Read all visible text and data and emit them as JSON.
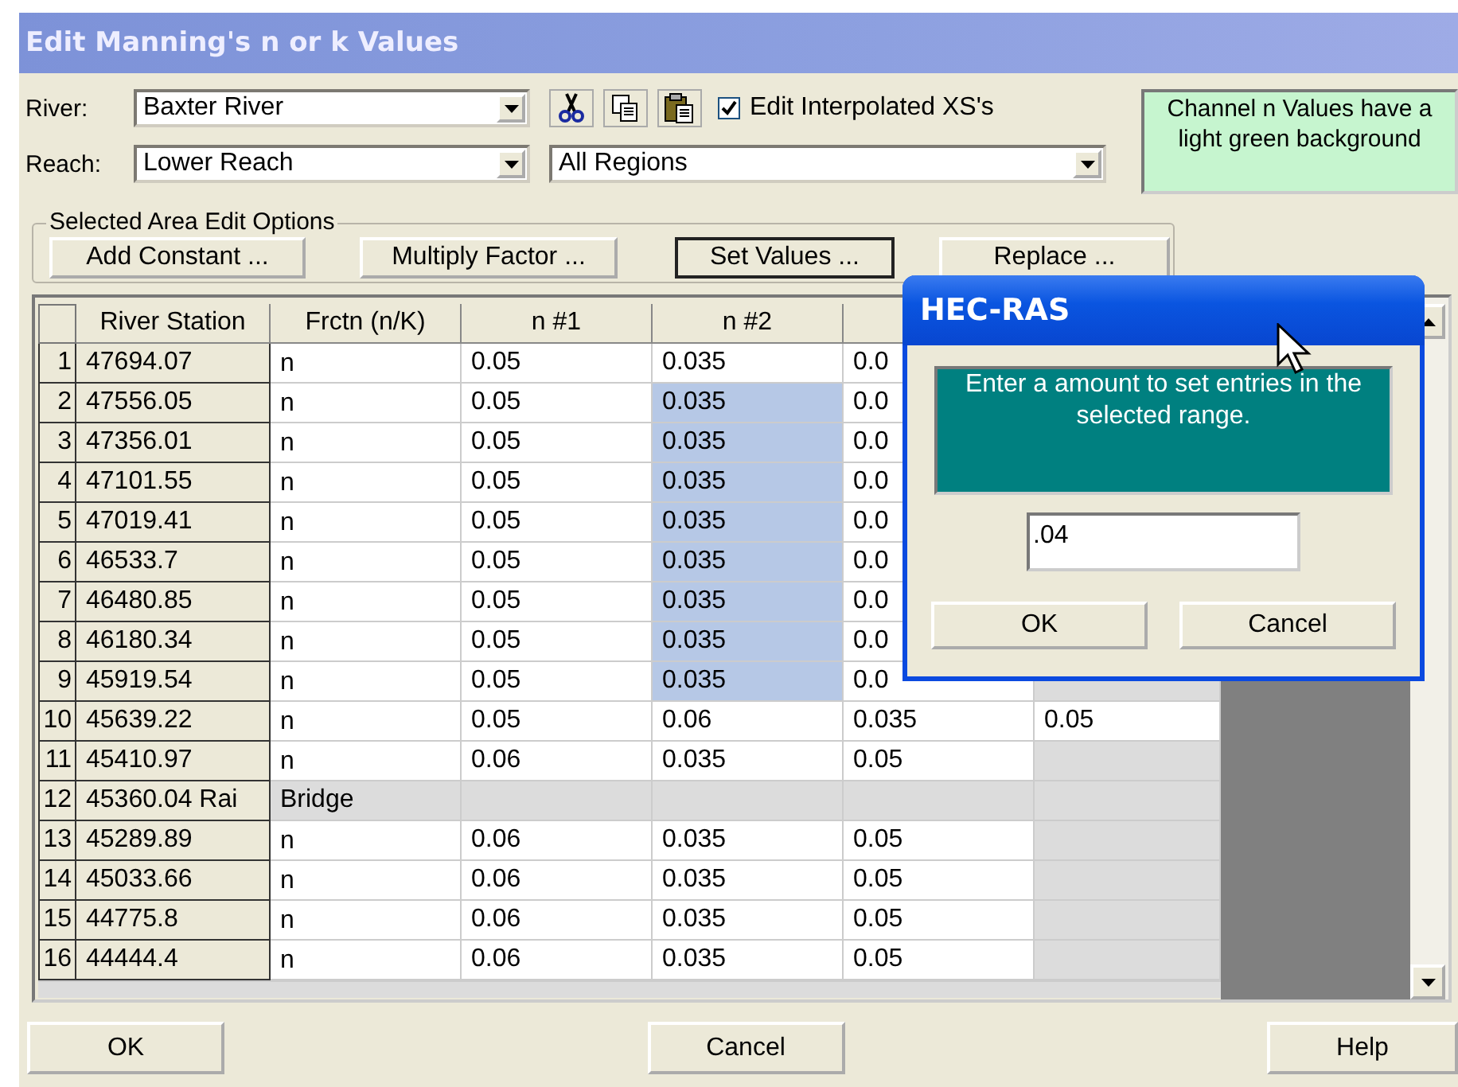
{
  "window": {
    "title": "Edit Manning's n or k Values"
  },
  "river": {
    "label": "River:",
    "value": "Baxter River"
  },
  "reach": {
    "label": "Reach:",
    "value": "Lower Reach"
  },
  "regions": {
    "value": "All Regions"
  },
  "interpolated": {
    "label": "Edit Interpolated XS's",
    "checked": true
  },
  "note": "Channel n Values have a light green background",
  "edit_options": {
    "title": "Selected Area Edit Options",
    "buttons": [
      {
        "label": "Add Constant ...",
        "focused": false
      },
      {
        "label": "Multiply Factor ...",
        "focused": false
      },
      {
        "label": "Set Values ...",
        "focused": true
      },
      {
        "label": "Replace ...",
        "focused": false
      }
    ]
  },
  "table": {
    "columns": [
      "River Station",
      "Frctn (n/K)",
      "n #1",
      "n #2"
    ],
    "rows": [
      {
        "num": "1",
        "station": "47694.07",
        "kind": "xs",
        "frctn": "n",
        "cells": [
          {
            "text": "0.05",
            "selected": false,
            "disabled": false
          },
          {
            "text": "0.035",
            "selected": false,
            "disabled": false
          },
          {
            "text": "0.0",
            "selected": false,
            "disabled": false
          }
        ]
      },
      {
        "num": "2",
        "station": "47556.05",
        "kind": "xs",
        "frctn": "n",
        "cells": [
          {
            "text": "0.05",
            "selected": false,
            "disabled": false
          },
          {
            "text": "0.035",
            "selected": true,
            "disabled": false
          },
          {
            "text": "0.0",
            "selected": false,
            "disabled": false
          }
        ]
      },
      {
        "num": "3",
        "station": "47356.01",
        "kind": "xs",
        "frctn": "n",
        "cells": [
          {
            "text": "0.05",
            "selected": false,
            "disabled": false
          },
          {
            "text": "0.035",
            "selected": true,
            "disabled": false
          },
          {
            "text": "0.0",
            "selected": false,
            "disabled": false
          }
        ]
      },
      {
        "num": "4",
        "station": "47101.55",
        "kind": "xs",
        "frctn": "n",
        "cells": [
          {
            "text": "0.05",
            "selected": false,
            "disabled": false
          },
          {
            "text": "0.035",
            "selected": true,
            "disabled": false
          },
          {
            "text": "0.0",
            "selected": false,
            "disabled": false
          }
        ]
      },
      {
        "num": "5",
        "station": "47019.41",
        "kind": "xs",
        "frctn": "n",
        "cells": [
          {
            "text": "0.05",
            "selected": false,
            "disabled": false
          },
          {
            "text": "0.035",
            "selected": true,
            "disabled": false
          },
          {
            "text": "0.0",
            "selected": false,
            "disabled": false
          }
        ]
      },
      {
        "num": "6",
        "station": "46533.7",
        "kind": "xs",
        "frctn": "n",
        "cells": [
          {
            "text": "0.05",
            "selected": false,
            "disabled": false
          },
          {
            "text": "0.035",
            "selected": true,
            "disabled": false
          },
          {
            "text": "0.0",
            "selected": false,
            "disabled": false
          }
        ]
      },
      {
        "num": "7",
        "station": "46480.85",
        "kind": "xs",
        "frctn": "n",
        "cells": [
          {
            "text": "0.05",
            "selected": false,
            "disabled": false
          },
          {
            "text": "0.035",
            "selected": true,
            "disabled": false
          },
          {
            "text": "0.0",
            "selected": false,
            "disabled": false
          }
        ]
      },
      {
        "num": "8",
        "station": "46180.34",
        "kind": "xs",
        "frctn": "n",
        "cells": [
          {
            "text": "0.05",
            "selected": false,
            "disabled": false
          },
          {
            "text": "0.035",
            "selected": true,
            "disabled": false
          },
          {
            "text": "0.0",
            "selected": false,
            "disabled": false
          }
        ]
      },
      {
        "num": "9",
        "station": "45919.54",
        "kind": "xs",
        "frctn": "n",
        "cells": [
          {
            "text": "0.05",
            "selected": false,
            "disabled": false
          },
          {
            "text": "0.035",
            "selected": true,
            "disabled": false
          },
          {
            "text": "0.0",
            "selected": false,
            "disabled": false
          }
        ]
      },
      {
        "num": "10",
        "station": "45639.22",
        "kind": "xs",
        "frctn": "n",
        "cells": [
          {
            "text": "0.05",
            "selected": false,
            "disabled": false
          },
          {
            "text": "0.06",
            "selected": false,
            "disabled": false
          },
          {
            "text": "0.035",
            "selected": false,
            "disabled": false
          },
          {
            "text": "0.05",
            "selected": false,
            "disabled": false
          }
        ]
      },
      {
        "num": "11",
        "station": "45410.97",
        "kind": "xs",
        "frctn": "n",
        "cells": [
          {
            "text": "0.06",
            "selected": false,
            "disabled": false
          },
          {
            "text": "0.035",
            "selected": false,
            "disabled": false
          },
          {
            "text": "0.05",
            "selected": false,
            "disabled": false
          },
          {
            "text": "",
            "selected": false,
            "disabled": true
          }
        ]
      },
      {
        "num": "12",
        "station": "45360.04 Rai",
        "kind": "bridge",
        "frctn": "Bridge",
        "cells": [
          {
            "text": "",
            "selected": false,
            "disabled": true
          },
          {
            "text": "",
            "selected": false,
            "disabled": true
          },
          {
            "text": "",
            "selected": false,
            "disabled": true
          },
          {
            "text": "",
            "selected": false,
            "disabled": true
          }
        ]
      },
      {
        "num": "13",
        "station": "45289.89",
        "kind": "xs",
        "frctn": "n",
        "cells": [
          {
            "text": "0.06",
            "selected": false,
            "disabled": false
          },
          {
            "text": "0.035",
            "selected": false,
            "disabled": false
          },
          {
            "text": "0.05",
            "selected": false,
            "disabled": false
          },
          {
            "text": "",
            "selected": false,
            "disabled": true
          }
        ]
      },
      {
        "num": "14",
        "station": "45033.66",
        "kind": "xs",
        "frctn": "n",
        "cells": [
          {
            "text": "0.06",
            "selected": false,
            "disabled": false
          },
          {
            "text": "0.035",
            "selected": false,
            "disabled": false
          },
          {
            "text": "0.05",
            "selected": false,
            "disabled": false
          },
          {
            "text": "",
            "selected": false,
            "disabled": true
          }
        ]
      },
      {
        "num": "15",
        "station": "44775.8",
        "kind": "xs",
        "frctn": "n",
        "cells": [
          {
            "text": "0.06",
            "selected": false,
            "disabled": false
          },
          {
            "text": "0.035",
            "selected": false,
            "disabled": false
          },
          {
            "text": "0.05",
            "selected": false,
            "disabled": false
          },
          {
            "text": "",
            "selected": false,
            "disabled": true
          }
        ]
      },
      {
        "num": "16",
        "station": "44444.4",
        "kind": "xs",
        "frctn": "n",
        "cells": [
          {
            "text": "0.06",
            "selected": false,
            "disabled": false
          },
          {
            "text": "0.035",
            "selected": false,
            "disabled": false
          },
          {
            "text": "0.05",
            "selected": false,
            "disabled": false
          },
          {
            "text": "",
            "selected": false,
            "disabled": true
          }
        ]
      }
    ]
  },
  "buttons": [
    "OK",
    "Cancel",
    "Help"
  ],
  "dialog": {
    "title": "HEC-RAS",
    "message": "Enter a amount to set entries in the selected range.",
    "value": ".04",
    "buttons": [
      "OK",
      "Cancel"
    ]
  }
}
